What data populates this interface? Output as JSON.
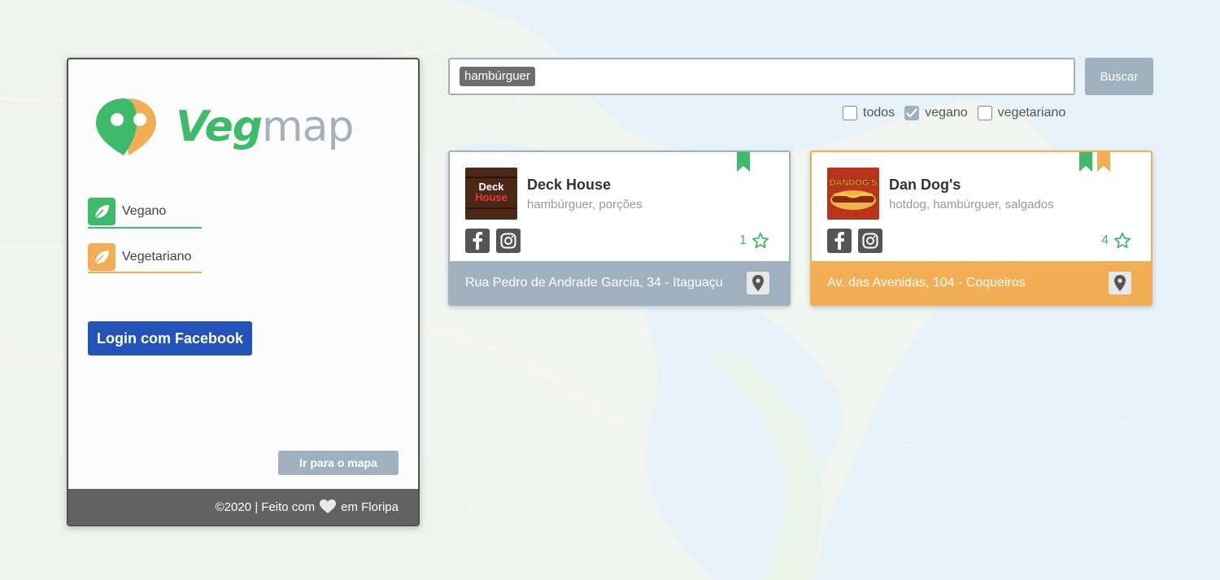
{
  "colors": {
    "vegan_green": "#3dbb6a",
    "vegetarian_orange": "#f2ae55",
    "slate": "#9fb0be",
    "facebook_blue": "#2353b8",
    "footer_gray": "#626262"
  },
  "brand": {
    "logo_part1": "Veg",
    "logo_part2": "map",
    "icon": "map-pin-heart-icon"
  },
  "legend": [
    {
      "label": "Vegano",
      "icon": "leaf-icon",
      "color": "#3dbb6a"
    },
    {
      "label": "Vegetariano",
      "icon": "leaf-icon",
      "color": "#f2ae55"
    }
  ],
  "auth": {
    "login_label": "Login com Facebook"
  },
  "panel": {
    "map_button_label": "Ir para o mapa"
  },
  "footer": {
    "prefix": "©2020 | Feito com",
    "suffix": "em Floripa",
    "icon": "heart-icon"
  },
  "search": {
    "value": "hambúrguer",
    "button_label": "Buscar"
  },
  "filters": [
    {
      "label": "todos",
      "checked": false
    },
    {
      "label": "vegano",
      "checked": true
    },
    {
      "label": "vegetariano",
      "checked": false
    }
  ],
  "results": [
    {
      "name": "Deck House",
      "tags": "hambúrguer, porções",
      "rating": "1",
      "address": "Rua Pedro de Andrade Garcia, 34 - Itaguaçu",
      "thumb_text": "Deck House",
      "ribbons": [
        "vegano"
      ],
      "border_color": "#9fb0be",
      "footer_color": "#9fb0be"
    },
    {
      "name": "Dan Dog's",
      "tags": "hotdog, hambúrguer, salgados",
      "rating": "4",
      "address": "Av. das Avenidas, 104 - Coqueiros",
      "thumb_text": "DANDOG'S",
      "ribbons": [
        "vegano",
        "vegetariano"
      ],
      "border_color": "#f2ae55",
      "footer_color": "#f2ae55"
    }
  ]
}
